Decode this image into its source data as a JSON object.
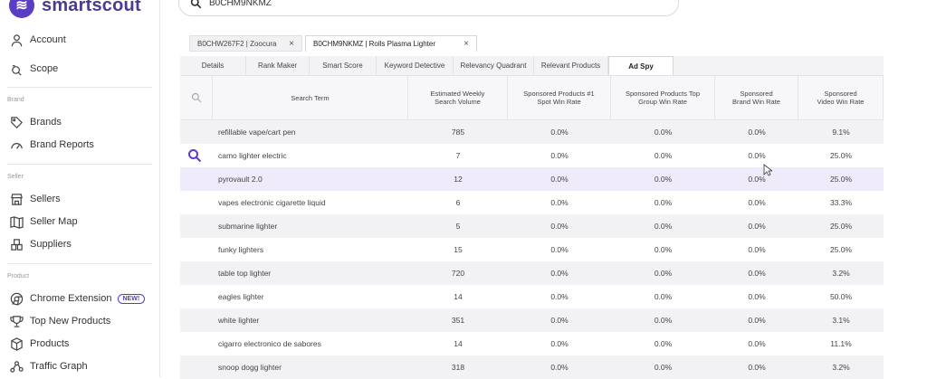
{
  "brand": {
    "name": "smartscout",
    "accent": "#5b3cc4"
  },
  "sidebar": {
    "items_top": [
      {
        "label": "Account",
        "icon": "user-icon"
      },
      {
        "label": "Scope",
        "icon": "scope-icon"
      }
    ],
    "sections": [
      {
        "title": "Brand",
        "items": [
          {
            "label": "Brands",
            "icon": "tag-icon"
          },
          {
            "label": "Brand Reports",
            "icon": "gauge-icon"
          }
        ]
      },
      {
        "title": "Seller",
        "items": [
          {
            "label": "Sellers",
            "icon": "store-icon"
          },
          {
            "label": "Seller Map",
            "icon": "map-icon"
          },
          {
            "label": "Suppliers",
            "icon": "suppliers-icon"
          }
        ]
      },
      {
        "title": "Product",
        "items": [
          {
            "label": "Chrome Extension",
            "icon": "chrome-icon",
            "badge": "NEW!"
          },
          {
            "label": "Top New Products",
            "icon": "trophy-icon"
          },
          {
            "label": "Products",
            "icon": "box-icon"
          },
          {
            "label": "Traffic Graph",
            "icon": "graph-icon"
          }
        ]
      }
    ]
  },
  "search": {
    "value": "B0CHM9NKMZ"
  },
  "product_tabs": [
    {
      "label": "B0CHW267F2 | Zoocura",
      "active": false
    },
    {
      "label": "B0CHM9NKMZ | Rolls Plasma Lighter",
      "active": true
    }
  ],
  "sub_tabs": [
    "Details",
    "Rank Maker",
    "Smart Score",
    "Keyword Detective",
    "Relevancy Quadrant",
    "Relevant Products",
    "Ad Spy"
  ],
  "active_sub_tab": "Ad Spy",
  "table": {
    "headers": [
      "Search Term",
      "Estimated Weekly Search Volume",
      "Sponsored Products #1 Spot Win Rate",
      "Sponsored Products Top Group Win Rate",
      "Sponsored Brand Win Rate",
      "Sponsored Video Win Rate"
    ],
    "rows": [
      [
        "refillable vape/cart pen",
        "785",
        "0.0%",
        "0.0%",
        "0.0%",
        "9.1%"
      ],
      [
        "camo lighter electric",
        "7",
        "0.0%",
        "0.0%",
        "0.0%",
        "25.0%"
      ],
      [
        "pyrovault 2.0",
        "12",
        "0.0%",
        "0.0%",
        "0.0%",
        "25.0%"
      ],
      [
        "vapes electronic cigarette liquid",
        "6",
        "0.0%",
        "0.0%",
        "0.0%",
        "33.3%"
      ],
      [
        "submarine lighter",
        "5",
        "0.0%",
        "0.0%",
        "0.0%",
        "25.0%"
      ],
      [
        "funky lighters",
        "15",
        "0.0%",
        "0.0%",
        "0.0%",
        "25.0%"
      ],
      [
        "table top lighter",
        "720",
        "0.0%",
        "0.0%",
        "0.0%",
        "3.2%"
      ],
      [
        "eagles lighter",
        "14",
        "0.0%",
        "0.0%",
        "0.0%",
        "50.0%"
      ],
      [
        "white lighter",
        "351",
        "0.0%",
        "0.0%",
        "0.0%",
        "3.1%"
      ],
      [
        "cigarro electronico de sabores",
        "14",
        "0.0%",
        "0.0%",
        "0.0%",
        "11.1%"
      ],
      [
        "snoop dogg lighter",
        "318",
        "0.0%",
        "0.0%",
        "0.0%",
        "3.2%"
      ]
    ]
  }
}
